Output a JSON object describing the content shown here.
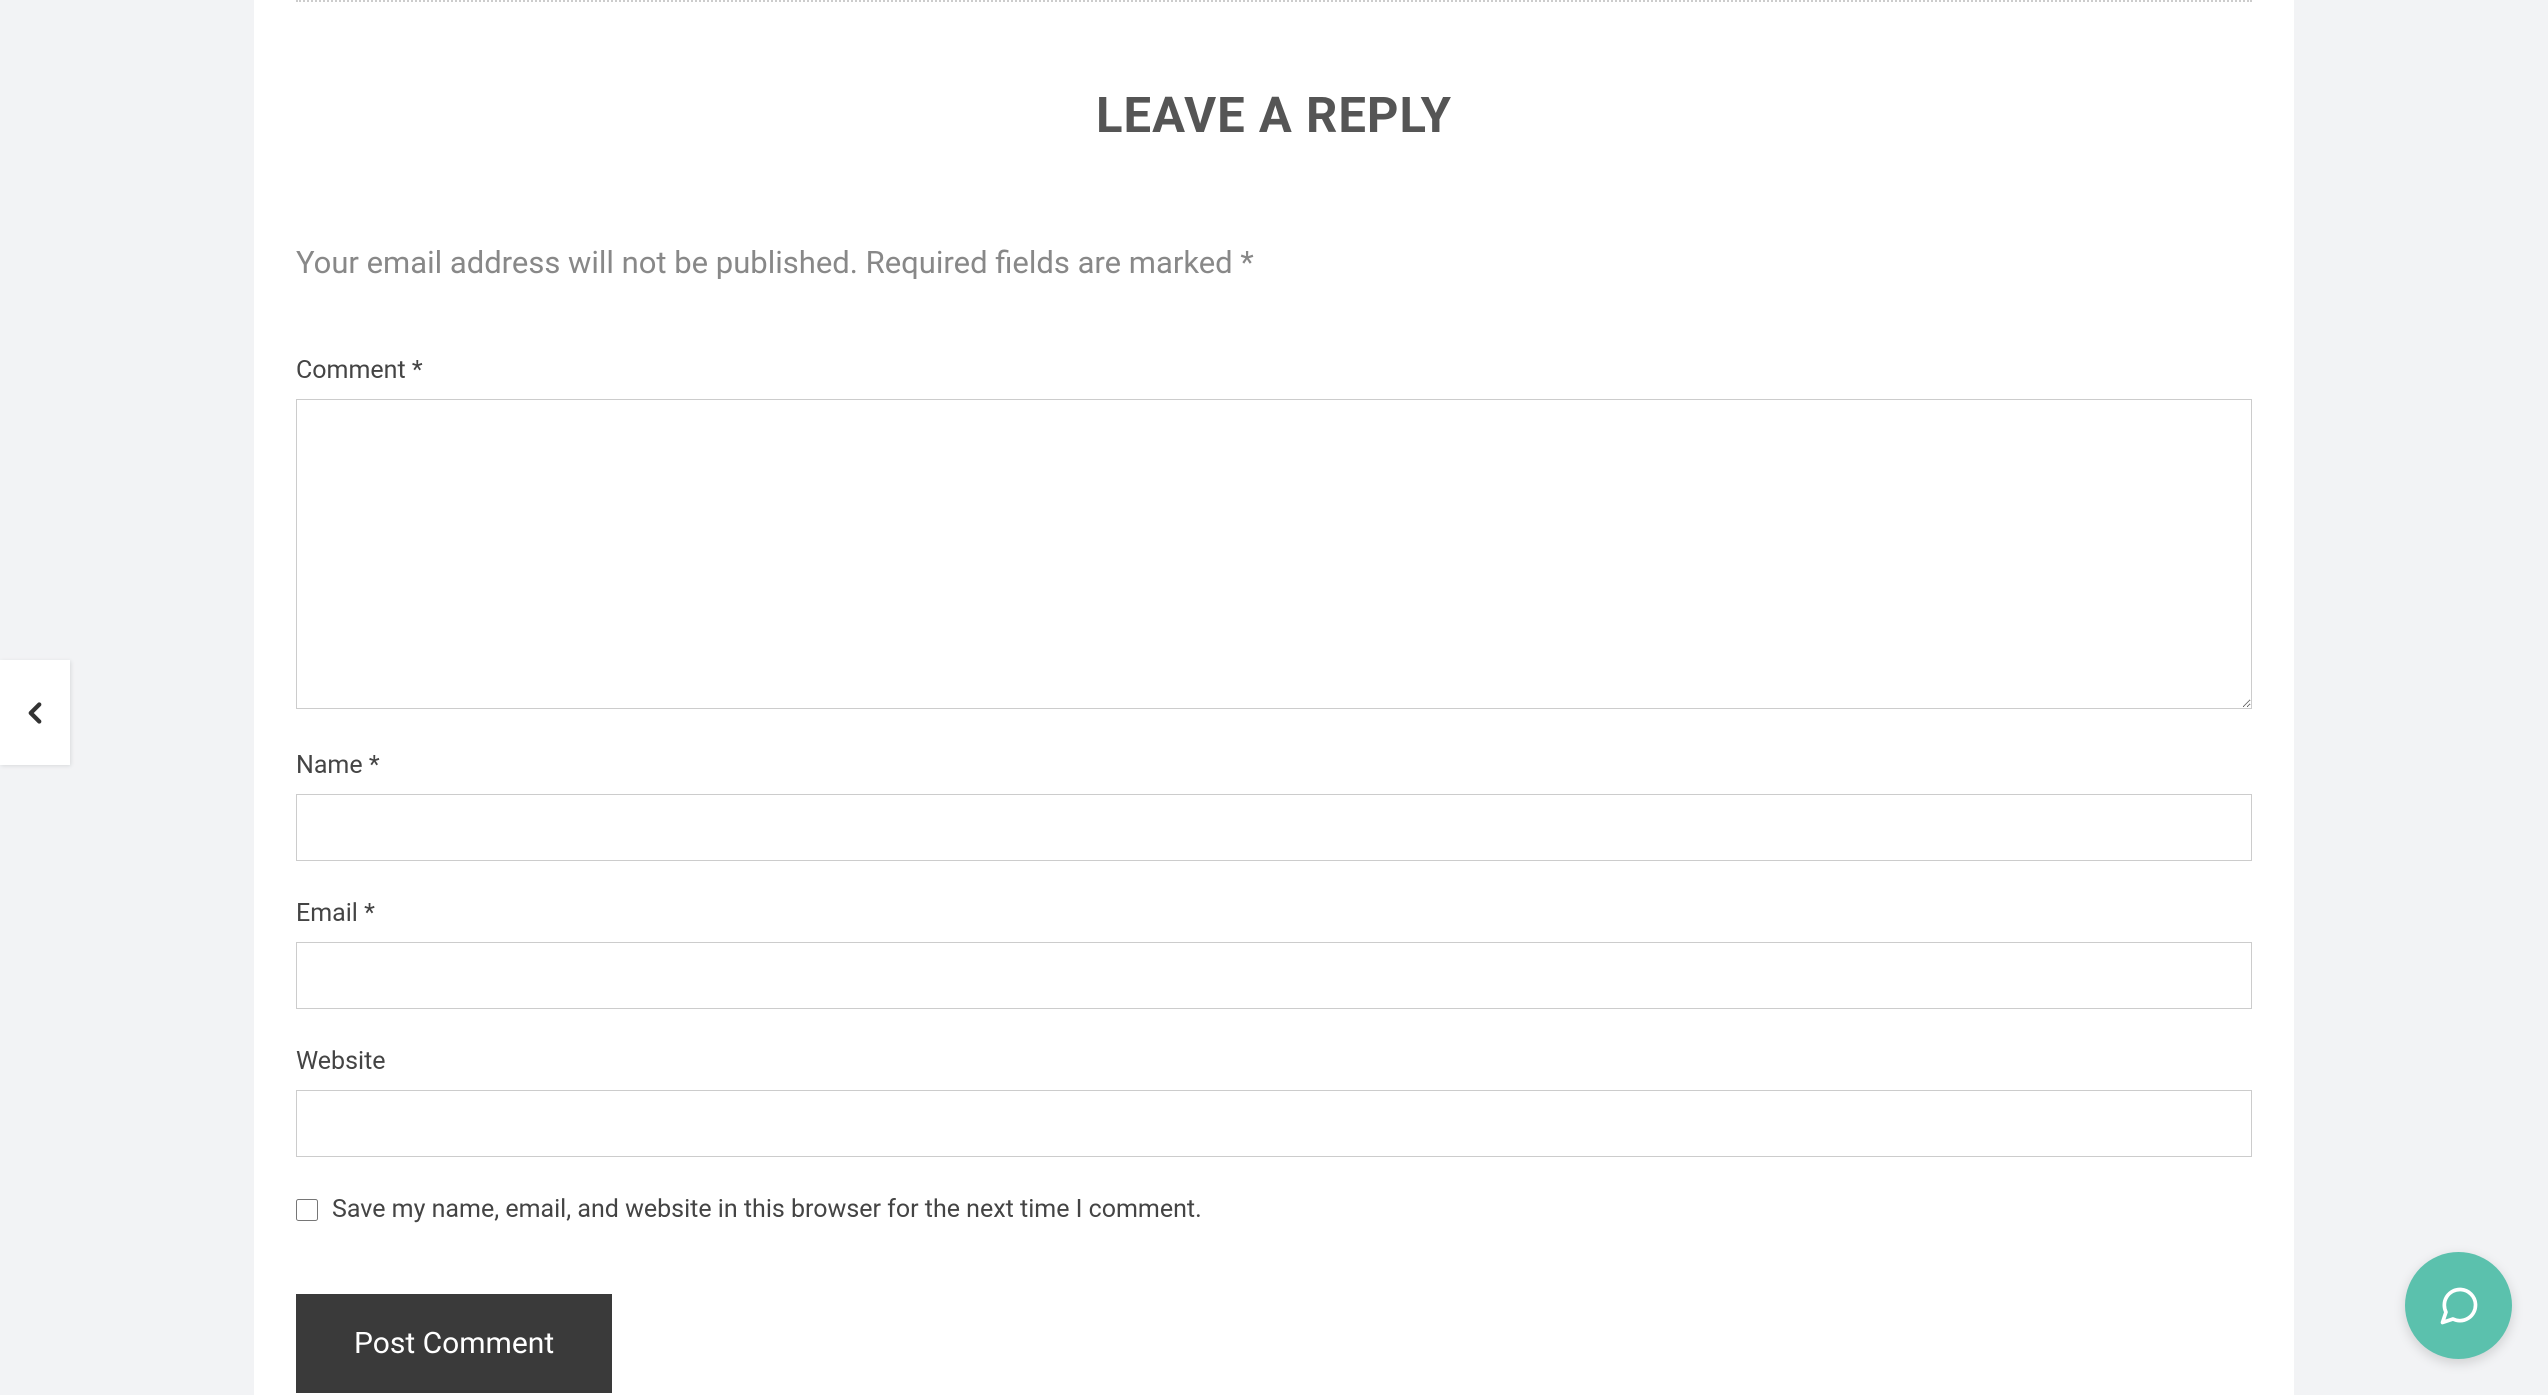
{
  "form": {
    "title": "LEAVE A REPLY",
    "notice": "Your email address will not be published. Required fields are marked *",
    "comment_label": "Comment ",
    "name_label": "Name ",
    "email_label": "Email ",
    "website_label": "Website",
    "required_mark": "*",
    "save_checkbox_label": "Save my name, email, and website in this browser for the next time I comment.",
    "submit_label": "Post Comment"
  },
  "colors": {
    "accent": "#5bc1ad",
    "button_bg": "#3a3a3a",
    "page_bg": "#f2f3f5"
  }
}
